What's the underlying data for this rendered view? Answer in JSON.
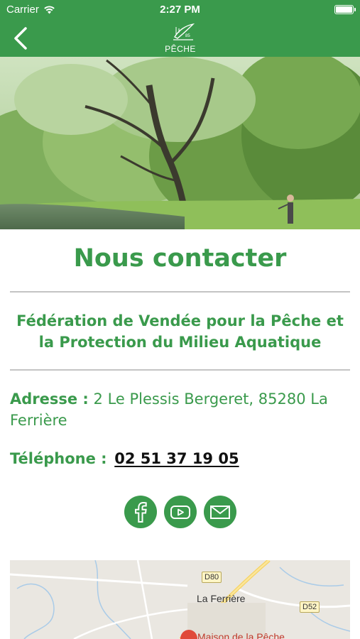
{
  "status_bar": {
    "carrier": "Carrier",
    "time": "2:27 PM"
  },
  "nav": {
    "logo_text": "PÊCHE"
  },
  "page": {
    "title": "Nous contacter",
    "organization": "Fédération de Vendée pour la Pêche et la Protection du Milieu Aquatique",
    "address_label": "Adresse :",
    "address_value": "2 Le Plessis Bergeret, 85280 La Ferrière",
    "phone_label": "Téléphone :",
    "phone_value": "02 51 37 19 05"
  },
  "social": [
    "facebook-icon",
    "youtube-icon",
    "mail-icon"
  ],
  "map": {
    "town": "La Ferrière",
    "road_d80": "D80",
    "road_d52": "D52",
    "poi_partial": "Maison de la Pêche"
  },
  "colors": {
    "primary_green": "#3a9a4c",
    "divider": "#c4c4c4"
  }
}
